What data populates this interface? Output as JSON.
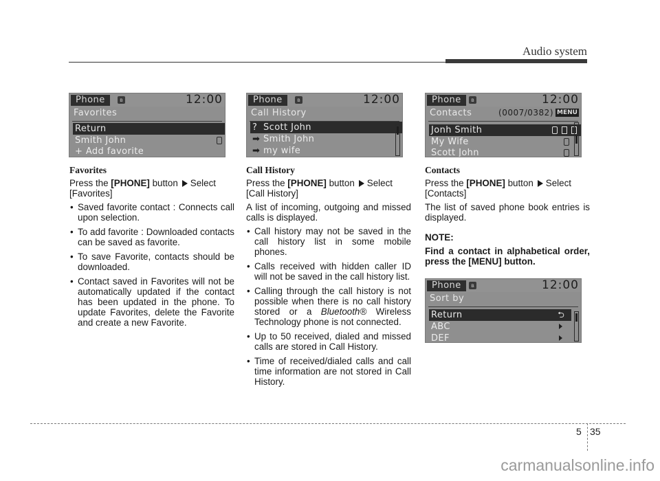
{
  "header": {
    "section_title": "Audio system"
  },
  "screens": {
    "favorites": {
      "tab": "Phone",
      "clock": "12:00",
      "subtitle": "Favorites",
      "rows": [
        {
          "label": "Return",
          "selected": true
        },
        {
          "label": "Smith John",
          "icon": "mobile-phone-icon"
        },
        {
          "label": "+ Add favorite"
        }
      ]
    },
    "call_history": {
      "tab": "Phone",
      "clock": "12:00",
      "subtitle": "Call History",
      "rows": [
        {
          "lead": "?",
          "label": "Scott John",
          "selected": true,
          "call_type": "missed"
        },
        {
          "lead": "➡",
          "label": "Smith John",
          "call_type": "outgoing"
        },
        {
          "lead": "➡",
          "label": "my wife",
          "call_type": "outgoing"
        }
      ]
    },
    "contacts": {
      "tab": "Phone",
      "clock": "12:00",
      "subtitle": "Contacts",
      "counter": "(0007/0382)",
      "menu_badge": "MENU",
      "rows": [
        {
          "label": "Jonh Smith",
          "selected": true,
          "icons": [
            "mobile-phone-icon",
            "home-icon",
            "office-icon"
          ]
        },
        {
          "label": "My Wife",
          "icons": [
            "mobile-phone-icon"
          ]
        },
        {
          "label": "Scott John",
          "icons": [
            "mobile-phone-icon"
          ]
        }
      ]
    },
    "sort_by": {
      "tab": "Phone",
      "clock": "12:00",
      "subtitle": "Sort by",
      "return_symbol": "⮌",
      "rows": [
        {
          "label": "Return",
          "selected": true
        },
        {
          "label": "ABC"
        },
        {
          "label": "DEF"
        }
      ]
    }
  },
  "sections": {
    "favorites": {
      "heading": "Favorites",
      "press_prefix": "Press the ",
      "button": "[PHONE]",
      "press_middle": " button",
      "press_select": "Select",
      "press_target": "[Favorites]",
      "bullets": [
        "Saved favorite contact : Connects call upon selection.",
        "To add favorite : Downloaded contacts can be saved as favorite.",
        "To save Favorite, contacts should be downloaded.",
        "Contact saved in Favorites will not be automatically updated if the contact has been updated in the phone. To update Favorites, delete the Favorite and create a new Favorite."
      ]
    },
    "call_history": {
      "heading": "Call History",
      "press_prefix": "Press the ",
      "button": "[PHONE]",
      "press_middle": " button",
      "press_select": "Select",
      "press_target": "[Call History]",
      "description": "A list of incoming, outgoing and missed calls is displayed.",
      "bullets": [
        "Call history may not be saved in the call history list in some mobile phones.",
        "Calls received with hidden caller ID will not be saved in the call history list."
      ],
      "bullet3_pre": "Calling through the call history is not possible when there is no call history stored or a ",
      "bullet3_brand": "Bluetooth®",
      "bullet3_post": " Wireless Technology phone is not connected.",
      "bullets_after": [
        "Up to 50 received, dialed and missed calls are stored in Call History.",
        "Time of received/dialed calls and call time information are not stored in Call History."
      ]
    },
    "contacts": {
      "heading": "Contacts",
      "press_prefix": "Press the ",
      "button": "[PHONE]",
      "press_middle": " button",
      "press_select": "Select",
      "press_target": "[Contacts]",
      "description": "The list of saved phone book entries is displayed.",
      "note_label": "NOTE:",
      "note_text": "Find a contact in alphabetical order, press the [MENU] button."
    }
  },
  "footer": {
    "chapter": "5",
    "page": "35",
    "watermark": "carmanualsonline.info"
  }
}
